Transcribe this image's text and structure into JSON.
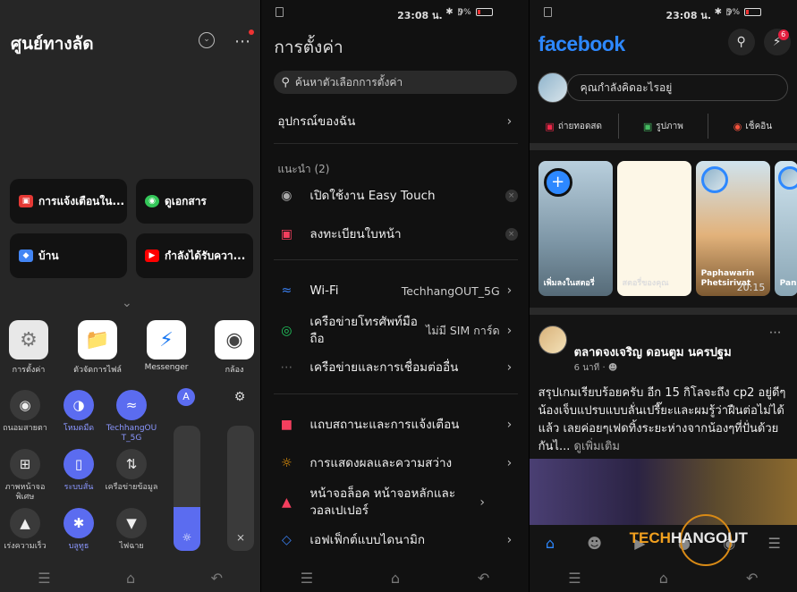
{
  "status": {
    "time": "23:08 น.",
    "battery": "9%",
    "icons": [
      "bluetooth-icon",
      "vibrate-icon",
      "wifi-icon"
    ]
  },
  "s1": {
    "title": "ศูนย์ทางลัด",
    "cards": [
      {
        "label": "การแจ้งเตือนใน...",
        "icon": "calendar-icon",
        "color": "#e53935"
      },
      {
        "label": "ดูเอกสาร",
        "icon": "eye-icon",
        "color": "#34c759"
      },
      {
        "label": "บ้าน",
        "icon": "maps-icon",
        "color": "#4285f4"
      },
      {
        "label": "กำลังได้รับควา...",
        "icon": "youtube-icon",
        "color": "#ff0000"
      }
    ],
    "apps": [
      {
        "label": "การตั้งค่า",
        "icon": "settings-app-icon"
      },
      {
        "label": "ตัวจัดการไฟล์",
        "icon": "files-app-icon"
      },
      {
        "label": "Messenger",
        "icon": "messenger-app-icon"
      },
      {
        "label": "กล้อง",
        "icon": "camera-app-icon"
      }
    ],
    "toggles": [
      {
        "label": "ถนอมสายตา",
        "icon": "eye-icon",
        "on": false
      },
      {
        "label": "โหมดมืด",
        "icon": "dark-mode-icon",
        "on": true
      },
      {
        "label": "TechhangOUT_5G",
        "icon": "wifi-icon",
        "on": true
      },
      {
        "label": "ภาพหน้าจอพิเศษ",
        "icon": "crop-icon",
        "on": false
      },
      {
        "label": "ระบบสั่น",
        "icon": "vibrate-icon",
        "on": true
      },
      {
        "label": "เครือข่ายข้อมูล",
        "icon": "data-icon",
        "on": false
      },
      {
        "label": "เร่งความเร็ว",
        "icon": "rocket-icon",
        "on": false
      },
      {
        "label": "บลูทูธ",
        "icon": "bluetooth-icon",
        "on": true
      },
      {
        "label": "ไฟฉาย",
        "icon": "flashlight-icon",
        "on": false
      }
    ],
    "brightness": 0.35,
    "volume": 0.0
  },
  "s2": {
    "title": "การตั้งค่า",
    "search_placeholder": "ค้นหาตัวเลือกการตั้งค่า",
    "my_device": "อุปกรณ์ของฉัน",
    "suggest_header": "แนะนำ (2)",
    "suggestions": [
      {
        "label": "เปิดใช้งาน Easy Touch",
        "icon": "easy-touch-icon"
      },
      {
        "label": "ลงทะเบียนใบหน้า",
        "icon": "face-id-icon"
      }
    ],
    "network": [
      {
        "label": "Wi-Fi",
        "value": "TechhangOUT_5G",
        "icon": "wifi-icon",
        "color": "#3b82f6"
      },
      {
        "label": "เครือข่ายโทรศัพท์มือถือ",
        "value": "ไม่มี SIM การ์ด",
        "icon": "globe-icon",
        "color": "#22c55e"
      },
      {
        "label": "เครือข่ายและการเชื่อมต่ออื่น",
        "value": "",
        "icon": "more-icon",
        "color": "#666666"
      }
    ],
    "display": [
      {
        "label": "แถบสถานะและการแจ้งเตือน",
        "icon": "notification-icon",
        "color": "#f43f5e"
      },
      {
        "label": "การแสดงผลและความสว่าง",
        "icon": "sun-icon",
        "color": "#f59e0b"
      },
      {
        "label": "หน้าจอล็อค หน้าจอหลักและวอลเปเปอร์",
        "icon": "shirt-icon",
        "color": "#f43f5e"
      },
      {
        "label": "เอฟเฟ็กต์แบบไดนามิก",
        "icon": "diamond-icon",
        "color": "#3b82f6"
      }
    ]
  },
  "s3": {
    "logo": "facebook",
    "badge": "6",
    "whats_on_mind": "คุณกำลังคิดอะไรอยู่",
    "actions": [
      {
        "label": "ถ่ายทอดสด",
        "icon": "live-icon",
        "color": "#f02849"
      },
      {
        "label": "รูปภาพ",
        "icon": "photo-icon",
        "color": "#45bd62"
      },
      {
        "label": "เช็คอิน",
        "icon": "checkin-icon",
        "color": "#f5533d"
      }
    ],
    "stories": [
      {
        "caption": "เพิ่มลงในสตอรี่"
      },
      {
        "caption": "สตอรี่ของคุณ"
      },
      {
        "caption": "Paphawarin Phetsirivat"
      },
      {
        "caption": "Pan"
      }
    ],
    "story_timer": "20:15",
    "post": {
      "author": "ตลาดจงเจริญ ดอนตูม นครปฐม",
      "time": "6 นาที",
      "text": "สรุปเกมเรียบร้อยครับ อีก 15 กิโลจะถึง cp2 อยู่ดีๆน้องเจ็บแปรบแบบลั่นเปรี๊ยะและผมรู้ว่าฝืนต่อไม่ได้แล้ว เลยค่อยๆเฟดทิ้งระยะห่างจากน้องๆที่ปั่นด้วยกันไ...",
      "see_more": "ดูเพิ่มเติม"
    },
    "watermark_a": "TECH",
    "watermark_b": "HANGOUT"
  }
}
